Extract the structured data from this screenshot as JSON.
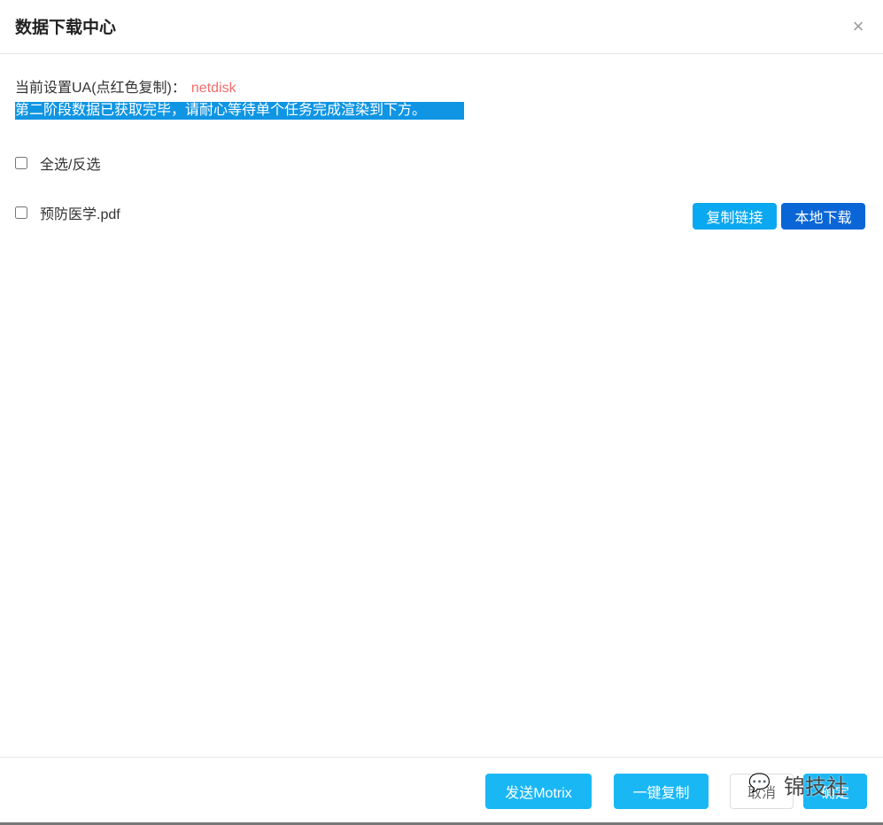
{
  "dialog": {
    "title": "数据下载中心"
  },
  "ua": {
    "label": "当前设置UA(点红色复制)：",
    "value": "netdisk"
  },
  "notice": "第二阶段数据已获取完毕，请耐心等待单个任务完成渲染到下方。",
  "select_all": {
    "label": "全选/反选",
    "checked": false
  },
  "files": [
    {
      "name": "预防医学.pdf",
      "checked": false,
      "copy_label": "复制链接",
      "download_label": "本地下载"
    }
  ],
  "footer": {
    "motrix": "发送Motrix",
    "copy_all": "一键复制",
    "cancel": "取消",
    "ok": "确定"
  },
  "watermark": "锦技社",
  "colors": {
    "primary": "#1ab7f5",
    "download": "#0a66d6",
    "copy": "#0aa8f0",
    "ua": "#f56c6c",
    "notice_bg": "#0f95e3"
  }
}
